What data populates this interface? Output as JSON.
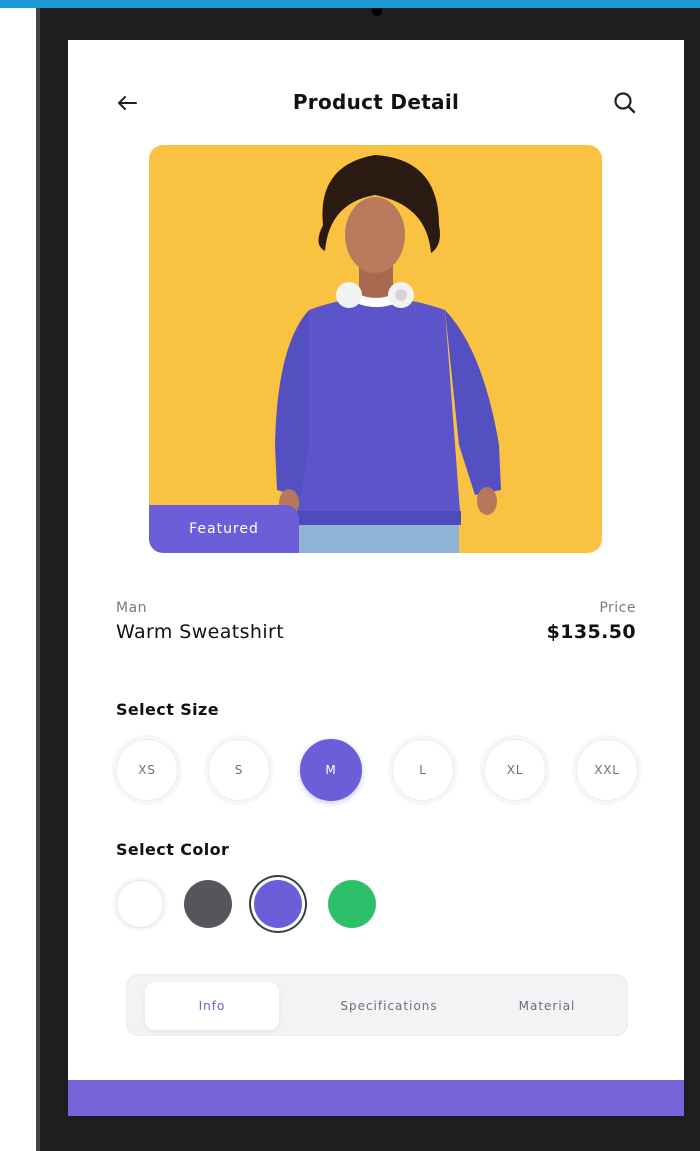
{
  "header": {
    "title": "Product Detail",
    "back_icon": "arrow-left-icon",
    "search_icon": "search-icon"
  },
  "product": {
    "badge": "Featured",
    "category": "Man",
    "name": "Warm Sweatshirt",
    "price_label": "Price",
    "price": "$135.50"
  },
  "size": {
    "label": "Select Size",
    "options": [
      "XS",
      "S",
      "M",
      "L",
      "XL",
      "XXL"
    ],
    "selected": "M"
  },
  "color": {
    "label": "Select Color",
    "options": [
      "#ffffff",
      "#55555c",
      "#6c5ed8",
      "#2ebf6b"
    ],
    "selected": "#6c5ed8"
  },
  "tabs": {
    "items": [
      "Info",
      "Specifications",
      "Material"
    ],
    "active": "Info"
  },
  "theme": {
    "accent": "#6c5ed8",
    "image_bg": "#f9c240"
  }
}
